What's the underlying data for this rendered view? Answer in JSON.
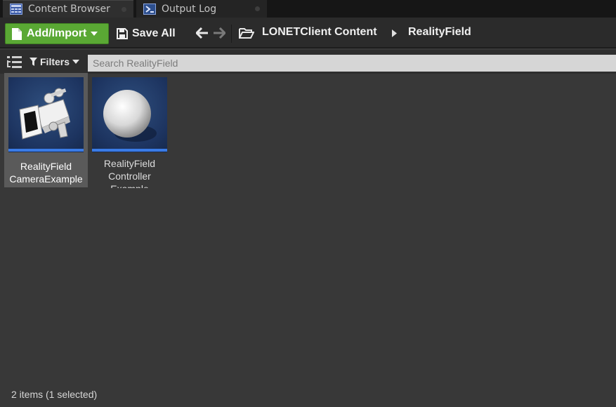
{
  "tabs": [
    {
      "label": "Content Browser",
      "icon": "content-browser-icon",
      "active": true
    },
    {
      "label": "Output Log",
      "icon": "output-log-icon",
      "active": false
    }
  ],
  "toolbar": {
    "add_import_label": "Add/Import",
    "save_all_label": "Save All",
    "accent_color": "#5aa834"
  },
  "breadcrumb": {
    "root": "LONETClient Content",
    "current": "RealityField"
  },
  "filter_bar": {
    "filters_label": "Filters",
    "search_placeholder": "Search RealityField"
  },
  "assets": [
    {
      "name_line1": "RealityField",
      "name_line2": "CameraExample",
      "selected": true,
      "thumbnail": "camera-icon"
    },
    {
      "name_line1": "RealityField",
      "name_line2": "Controller",
      "name_line3": "Example",
      "selected": false,
      "thumbnail": "sphere-icon"
    }
  ],
  "status_bar": {
    "text": "2 items (1 selected)"
  }
}
